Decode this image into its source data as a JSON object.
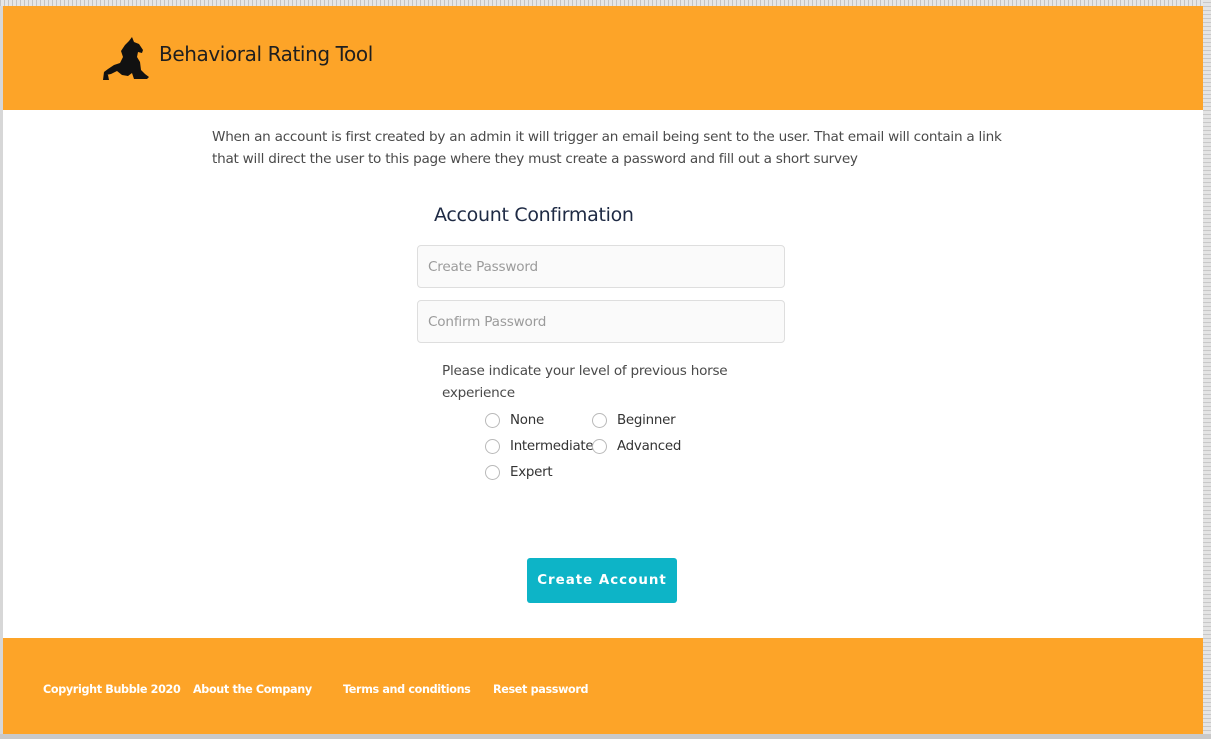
{
  "header": {
    "title": "Behavioral Rating Tool",
    "logo_icon": "rearing-horse-icon",
    "background_color": "#fda428"
  },
  "intro_text": "When an account is first created by an admin it will trigger an email being sent to the user. That email will contain a link that will direct the user to this page where they must create a password and fill out a short survey",
  "form": {
    "title": "Account Confirmation",
    "password_placeholder": "Create Password",
    "confirm_placeholder": "Confirm Password",
    "survey_question": "Please indicate your level of previous horse experience",
    "options": [
      "None",
      "Beginner",
      "Intermediate",
      "Advanced",
      "Expert"
    ],
    "submit_label": "Create Account",
    "submit_color": "#0db4c7"
  },
  "footer": {
    "copyright": "Copyright Bubble 2020",
    "about": "About the Company",
    "terms": "Terms and conditions",
    "reset": "Reset password",
    "background_color": "#fda428"
  }
}
